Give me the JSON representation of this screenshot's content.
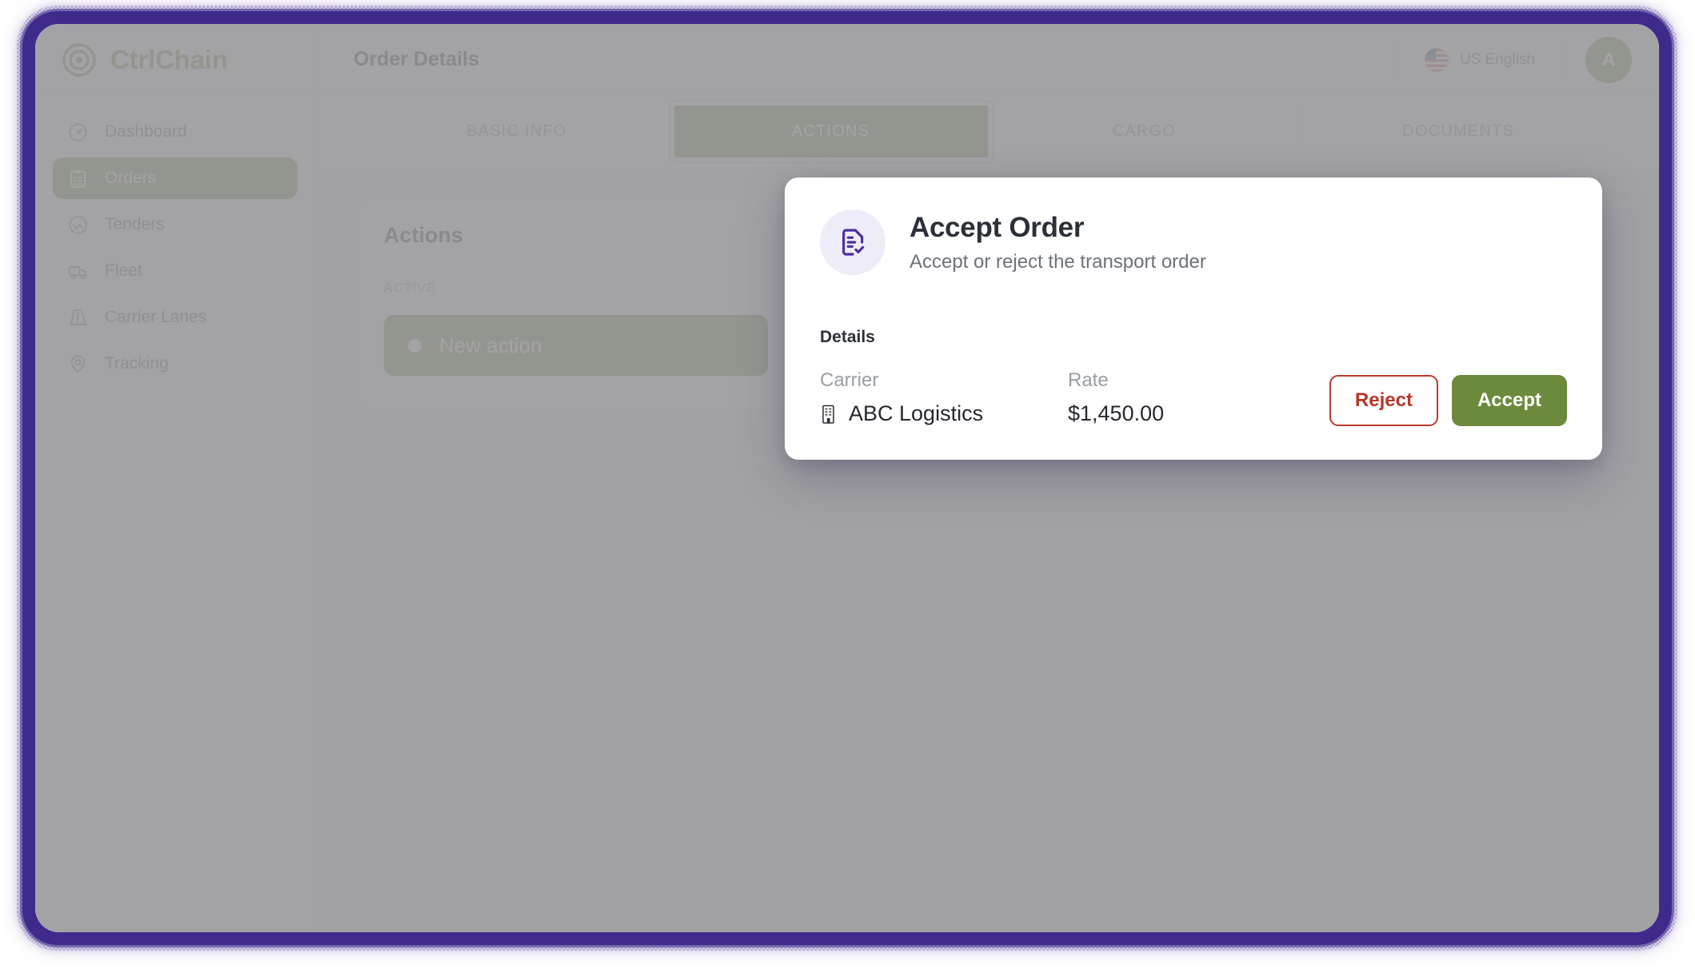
{
  "brand": {
    "name": "CtrlChain",
    "logo_icon": "target-circle-icon",
    "color": "#7b9444"
  },
  "sidebar": {
    "items": [
      {
        "label": "Dashboard",
        "icon": "gauge-icon",
        "active": false
      },
      {
        "label": "Orders",
        "icon": "clipboard-icon",
        "active": true
      },
      {
        "label": "Tenders",
        "icon": "handshake-icon",
        "active": false
      },
      {
        "label": "Fleet",
        "icon": "truck-icon",
        "active": false
      },
      {
        "label": "Carrier Lanes",
        "icon": "route-icon",
        "active": false
      },
      {
        "label": "Tracking",
        "icon": "map-pin-icon",
        "active": false
      }
    ]
  },
  "header": {
    "title": "Order Details",
    "language": {
      "label": "US English",
      "flag_icon": "us-flag-icon"
    },
    "avatar": {
      "initial": "A",
      "color": "#76903f"
    }
  },
  "tabs": [
    {
      "label": "BASIC INFO",
      "active": false
    },
    {
      "label": "ACTIONS",
      "active": true
    },
    {
      "label": "CARGO",
      "active": false
    },
    {
      "label": "DOCUMENTS",
      "active": false
    }
  ],
  "main": {
    "actions_card": {
      "heading": "Actions",
      "group_label": "ACTIVE",
      "items": [
        {
          "label": "New action",
          "status_dot": "filled-dot",
          "selected": true
        }
      ]
    }
  },
  "modal": {
    "icon": "document-check-icon",
    "title": "Accept Order",
    "subtitle": "Accept or reject the transport order",
    "details_label": "Details",
    "fields": [
      {
        "key": "Carrier",
        "value": "ABC Logistics",
        "icon": "building-icon"
      },
      {
        "key": "Rate",
        "value": "$1,450.00",
        "icon": ""
      }
    ],
    "buttons": {
      "reject": "Reject",
      "accept": "Accept"
    }
  },
  "theme": {
    "accent_green": "#76903f",
    "frame_purple": "#3f2a8c",
    "reject_red": "#c0392b",
    "modal_icon_bg": "#eeecf8",
    "modal_icon_fg": "#4c2f9e"
  }
}
